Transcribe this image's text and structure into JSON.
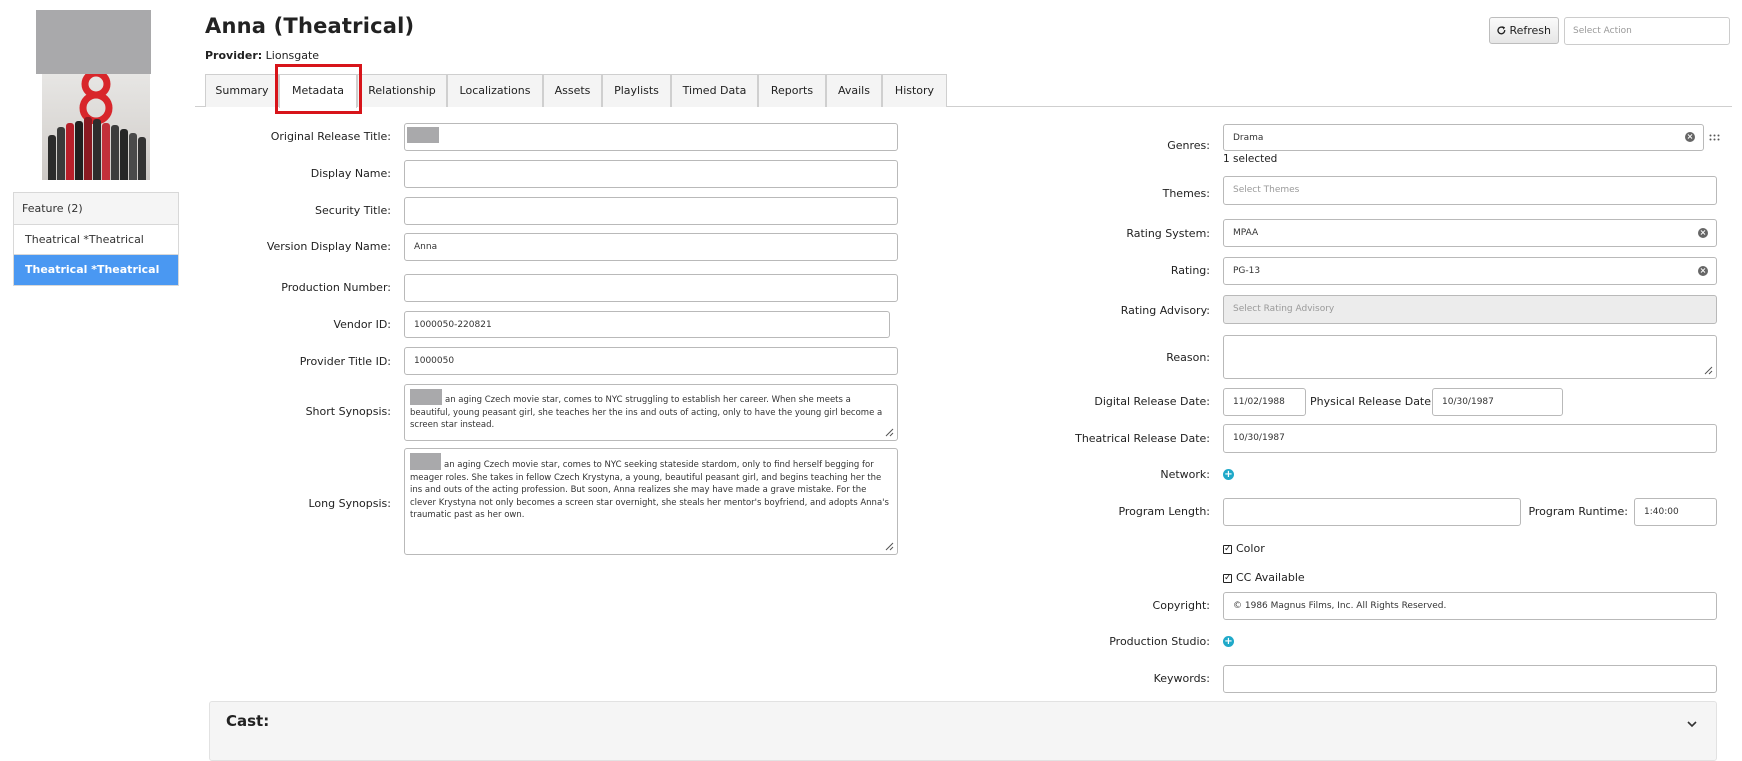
{
  "header": {
    "title": "Anna (Theatrical)",
    "provider_label": "Provider:",
    "provider_value": "Lionsgate",
    "refresh_label": "Refresh",
    "action_placeholder": "Select Action"
  },
  "tabs": [
    "Summary",
    "Metadata",
    "Relationship",
    "Localizations",
    "Assets",
    "Playlists",
    "Timed Data",
    "Reports",
    "Avails",
    "History"
  ],
  "active_tab": "Metadata",
  "sidebar": {
    "group_label": "Feature (2)",
    "items": [
      {
        "label": "Theatrical *Theatrical",
        "active": false
      },
      {
        "label": "Theatrical *Theatrical",
        "active": true
      }
    ]
  },
  "left_form": {
    "original_release_title": {
      "label": "Original Release Title:",
      "value": ""
    },
    "display_name": {
      "label": "Display Name:",
      "value": ""
    },
    "security_title": {
      "label": "Security Title:",
      "value": ""
    },
    "version_display_name": {
      "label": "Version Display Name:",
      "value": "Anna"
    },
    "production_number": {
      "label": "Production Number:",
      "value": ""
    },
    "vendor_id": {
      "label": "Vendor ID:",
      "value": "1000050-220821"
    },
    "provider_title_id": {
      "label": "Provider Title ID:",
      "value": "1000050"
    },
    "short_synopsis": {
      "label": "Short Synopsis:",
      "value": "an aging Czech movie star, comes to NYC struggling to establish her career. When she meets a beautiful, young peasant girl, she teaches her the ins and outs of acting, only to have the young girl become a screen star instead."
    },
    "long_synopsis": {
      "label": "Long Synopsis:",
      "value": "an aging Czech movie star, comes to NYC seeking stateside stardom, only to find herself begging for meager roles. She takes in fellow Czech Krystyna, a young, beautiful peasant girl, and begins teaching her the ins and outs of the acting profession. But soon, Anna realizes she may have made a grave mistake. For the clever Krystyna not only becomes a screen star overnight, she steals her mentor's boyfriend, and adopts Anna's traumatic past as her own."
    }
  },
  "right_form": {
    "genres": {
      "label": "Genres:",
      "value": "Drama",
      "count": "1 selected"
    },
    "themes": {
      "label": "Themes:",
      "placeholder": "Select Themes"
    },
    "rating_system": {
      "label": "Rating System:",
      "value": "MPAA"
    },
    "rating": {
      "label": "Rating:",
      "value": "PG-13"
    },
    "rating_advisory": {
      "label": "Rating Advisory:",
      "placeholder": "Select Rating Advisory"
    },
    "reason": {
      "label": "Reason:",
      "value": ""
    },
    "digital_release_date": {
      "label": "Digital Release Date:",
      "value": "11/02/1988"
    },
    "physical_release_date": {
      "label": "Physical Release Date:",
      "value": "10/30/1987"
    },
    "theatrical_release_date": {
      "label": "Theatrical Release Date:",
      "value": "10/30/1987"
    },
    "network": {
      "label": "Network:"
    },
    "program_length": {
      "label": "Program Length:",
      "value": ""
    },
    "program_runtime": {
      "label": "Program Runtime:",
      "value": "1:40:00"
    },
    "color": {
      "label": "Color",
      "checked": true
    },
    "cc_available": {
      "label": "CC Available",
      "checked": true
    },
    "copyright": {
      "label": "Copyright:",
      "value": "© 1986 Magnus Films, Inc. All Rights Reserved."
    },
    "production_studio": {
      "label": "Production Studio:"
    },
    "keywords": {
      "label": "Keywords:",
      "value": ""
    }
  },
  "cast": {
    "title": "Cast:"
  },
  "icons": {
    "refresh": "refresh-icon",
    "clear": "clear-icon",
    "add": "plus-circle-icon",
    "check": "checkmark-icon",
    "chevron": "chevron-down-icon",
    "drag": "drag-handle-icon",
    "resize": "resize-grip-icon"
  },
  "colors": {
    "accent": "#4a98f2",
    "highlight": "#d7141a",
    "add_icon": "#1fa9c9"
  }
}
